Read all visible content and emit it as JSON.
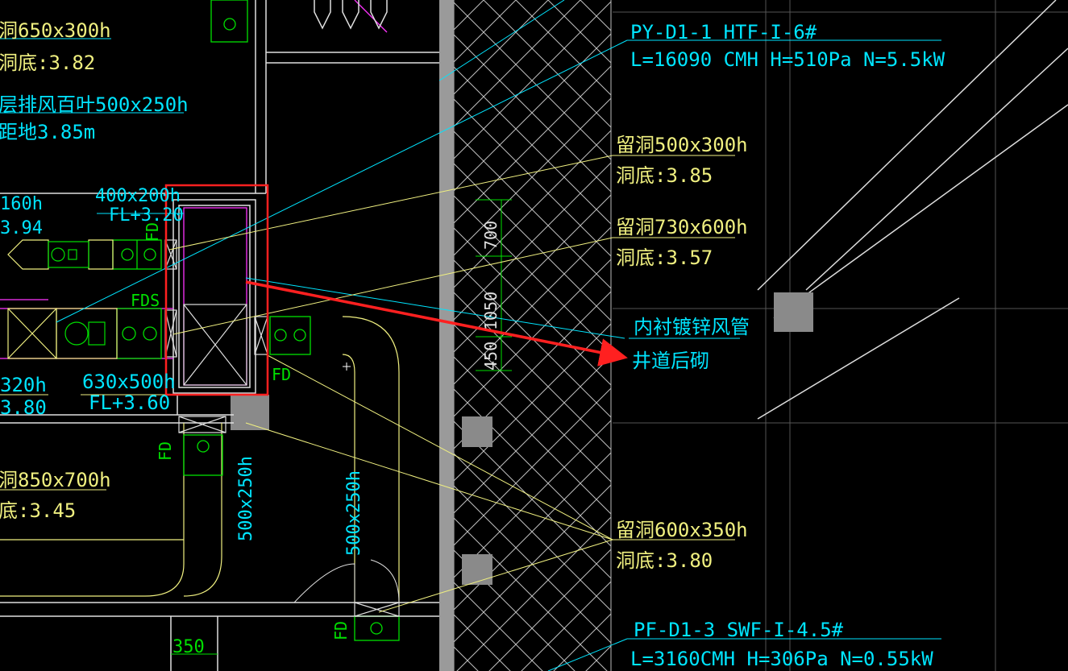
{
  "colors": {
    "background": "#000000",
    "cyan": "#00E5FF",
    "yellow": "#F0F080",
    "white": "#FFFFFF",
    "green": "#00E000",
    "magenta": "#FF33FF",
    "red": "#FF2020",
    "gray": "#8A8A8A",
    "hatch": "#FFFFFF",
    "guide": "#707070"
  },
  "labels": {
    "left_top_size": "洞650x300h",
    "left_top_bottom": "洞底:3.82",
    "left_exhaust": "层排风百叶500x250h",
    "left_height": "距地3.85m",
    "duct_size_top": "400x200h",
    "duct_fl_top": "FL+3.20",
    "left_partial_size": "160h",
    "left_partial_bottom": "3.94",
    "fd_vert_top": "FD",
    "fds": "FDS",
    "left_320": "320h",
    "left_380": "3.80",
    "duct_630": "630x500h",
    "fl_360": "FL+3.60",
    "fd_right": "FD",
    "fd_lower_left": "FD",
    "left_850": "洞850x700h",
    "left_345": "底:3.45",
    "duct_500x250_a": "500x250h",
    "duct_500x250_b": "500x250h",
    "fd_bottom": "FD",
    "dim_350": "350",
    "dim_700": "700",
    "dim_1050": "1050",
    "dim_450": "450",
    "py_tag": "PY-D1-1 HTF-I-6#",
    "py_spec": "L=16090 CMH H=510Pa N=5.5kW",
    "hole1_size": "留洞500x300h",
    "hole1_bottom": "洞底:3.85",
    "hole2_size": "留洞730x600h",
    "hole2_bottom": "洞底:3.57",
    "lined_duct": "内衬镀锌风管",
    "shaft_wall": "井道后砌",
    "hole3_size": "留洞600x350h",
    "hole3_bottom": "洞底:3.80",
    "pf_tag": "PF-D1-3 SWF-I-4.5#",
    "pf_spec": "L=3160CMH H=306Pa N=0.55kW"
  },
  "icons": [
    "fire-damper-icon",
    "fan-icon",
    "gate-valve-icon",
    "column-icon",
    "arrow-down-icon"
  ]
}
